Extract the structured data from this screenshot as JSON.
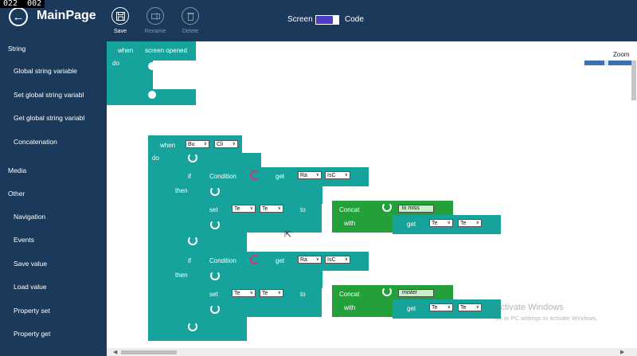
{
  "recorder": {
    "left_counter": "022",
    "right_counter": "002"
  },
  "header": {
    "title": "MainPage",
    "save_label": "Save",
    "rename_label": "Rename",
    "delete_label": "Delete",
    "screen_label": "Screen",
    "code_label": "Code"
  },
  "sidebar": {
    "items": [
      {
        "label": "String",
        "kind": "category"
      },
      {
        "label": "Global string variable",
        "kind": "item"
      },
      {
        "label": "Set global string variabl",
        "kind": "item"
      },
      {
        "label": "Get global string variabl",
        "kind": "item"
      },
      {
        "label": "Concatenation",
        "kind": "item"
      },
      {
        "label": "Media",
        "kind": "category"
      },
      {
        "label": "Other",
        "kind": "category"
      },
      {
        "label": "Navigation",
        "kind": "item"
      },
      {
        "label": "Events",
        "kind": "item"
      },
      {
        "label": "Save value",
        "kind": "item"
      },
      {
        "label": "Load value",
        "kind": "item"
      },
      {
        "label": "Property set",
        "kind": "item"
      },
      {
        "label": "Property get",
        "kind": "item"
      }
    ]
  },
  "canvas": {
    "zoom_label": "Zoom",
    "zoom_fraction": 0.45,
    "event1": {
      "when": "when",
      "event": "screen opened",
      "do": "do"
    },
    "event2": {
      "when": "when",
      "component": "Bu",
      "event": "Cli",
      "do": "do"
    },
    "if1": {
      "if": "if",
      "condition": "Condition",
      "get": "get",
      "component": "Ra",
      "property": "IsC",
      "then": "then",
      "set": "set",
      "set_component": "Te",
      "set_property": "Te",
      "to": "to",
      "concat": "Concat",
      "with": "with",
      "text": "lo miss",
      "get2": "get",
      "get2_component": "Te",
      "get2_property": "Te"
    },
    "if2": {
      "if": "if",
      "condition": "Condition",
      "get": "get",
      "component": "Ra",
      "property": "IsC",
      "then": "then",
      "set": "set",
      "set_component": "Te",
      "set_property": "Te",
      "to": "to",
      "concat": "Concat",
      "with": "with",
      "text": "mister",
      "get2": "get",
      "get2_component": "Te",
      "get2_property": "Te"
    }
  },
  "watermark": {
    "title": "Activate Windows",
    "subtitle": "Go to PC settings to activate Windows."
  },
  "colors": {
    "header_bg": "#1b3a5b",
    "event_block": "#15a39c",
    "concat_block": "#23a03a",
    "toggle": "#4c3ec4"
  }
}
